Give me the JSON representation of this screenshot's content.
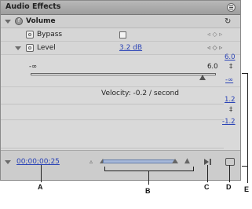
{
  "panel": {
    "title": "Audio Effects",
    "effect_name": "Volume",
    "param_bypass": "Bypass",
    "param_level": "Level",
    "level_value": "3.2 dB"
  },
  "graph": {
    "slider_min": "-∞",
    "slider_max": "6.0",
    "slider_position_fraction": 0.93,
    "value_scale_max": "6.0",
    "value_scale_min": "-∞",
    "velocity_scale_max": "1.2",
    "velocity_scale_min": "-1.2",
    "velocity_text": "Velocity: -0.2 / second"
  },
  "footer": {
    "timecode": "00;00;00;25"
  },
  "callouts": {
    "a": "A",
    "b": "B",
    "c": "C",
    "d": "D",
    "e": "E"
  },
  "icons": [
    "menu-icon",
    "reset-icon",
    "stopwatch-icon",
    "keyframe-nav-icon",
    "play-icon",
    "loop-icon"
  ]
}
